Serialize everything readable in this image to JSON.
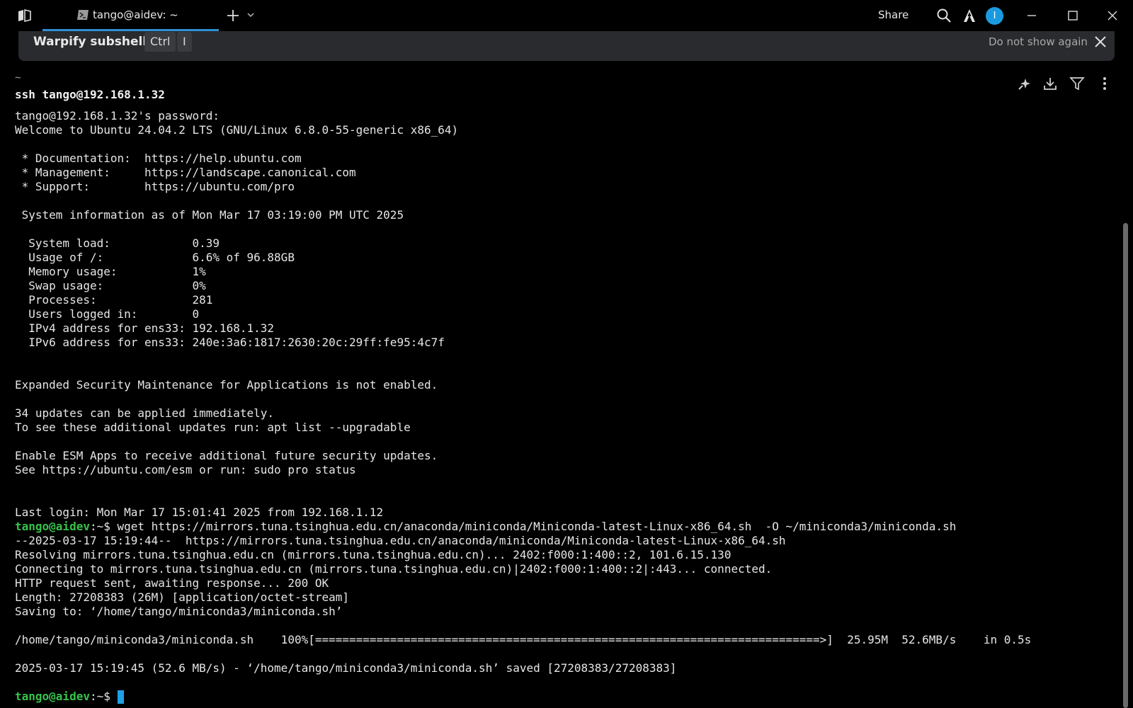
{
  "titlebar": {
    "tab_label": "tango@aidev: ~",
    "share_label": "Share",
    "avatar_initial": "I"
  },
  "banner": {
    "title": "Warpify subshell",
    "key1": "Ctrl",
    "key2": "I",
    "dont_show": "Do not show again"
  },
  "terminal": {
    "block_dir": "~",
    "command": "ssh tango@192.168.1.32",
    "lines": [
      "tango@192.168.1.32's password:",
      "Welcome to Ubuntu 24.04.2 LTS (GNU/Linux 6.8.0-55-generic x86_64)",
      "",
      " * Documentation:  https://help.ubuntu.com",
      " * Management:     https://landscape.canonical.com",
      " * Support:        https://ubuntu.com/pro",
      "",
      " System information as of Mon Mar 17 03:19:00 PM UTC 2025",
      "",
      "  System load:            0.39",
      "  Usage of /:             6.6% of 96.88GB",
      "  Memory usage:           1%",
      "  Swap usage:             0%",
      "  Processes:              281",
      "  Users logged in:        0",
      "  IPv4 address for ens33: 192.168.1.32",
      "  IPv6 address for ens33: 240e:3a6:1817:2630:20c:29ff:fe95:4c7f",
      "",
      "",
      "Expanded Security Maintenance for Applications is not enabled.",
      "",
      "34 updates can be applied immediately.",
      "To see these additional updates run: apt list --upgradable",
      "",
      "Enable ESM Apps to receive additional future security updates.",
      "See https://ubuntu.com/esm or run: sudo pro status",
      "",
      "",
      "Last login: Mon Mar 17 15:01:41 2025 from 192.168.1.12"
    ],
    "prompt": "tango@aidev",
    "prompt_suffix": ":~$ ",
    "wget_command": "wget https://mirrors.tuna.tsinghua.edu.cn/anaconda/miniconda/Miniconda-latest-Linux-x86_64.sh  -O ~/miniconda3/miniconda.sh",
    "output_lines": [
      "--2025-03-17 15:19:44--  https://mirrors.tuna.tsinghua.edu.cn/anaconda/miniconda/Miniconda-latest-Linux-x86_64.sh",
      "Resolving mirrors.tuna.tsinghua.edu.cn (mirrors.tuna.tsinghua.edu.cn)... 2402:f000:1:400::2, 101.6.15.130",
      "Connecting to mirrors.tuna.tsinghua.edu.cn (mirrors.tuna.tsinghua.edu.cn)|2402:f000:1:400::2|:443... connected.",
      "HTTP request sent, awaiting response... 200 OK",
      "Length: 27208383 (26M) [application/octet-stream]",
      "Saving to: ‘/home/tango/miniconda3/miniconda.sh’",
      "",
      "/home/tango/miniconda3/miniconda.sh    100%[==========================================================================>]  25.95M  52.6MB/s    in 0.5s",
      "",
      "2025-03-17 15:19:45 (52.6 MB/s) - ‘/home/tango/miniconda3/miniconda.sh’ saved [27208383/27208383]",
      ""
    ]
  },
  "icons": {
    "app_menu": "app-menu-icon",
    "tab": "terminal-icon",
    "new_tab": "plus-icon",
    "tab_dropdown": "chevron-down-icon",
    "search": "search-icon",
    "warp": "warp-icon",
    "close": "close-icon",
    "ai": "sparkle-icon",
    "save": "download-icon",
    "filter": "filter-icon",
    "more": "more-vertical-icon"
  },
  "colors": {
    "background": "#000000",
    "prompt": "#37c24a",
    "accent": "#2f8fd6",
    "cursor": "#1ea0e6",
    "banner": "#2a2b2e"
  }
}
